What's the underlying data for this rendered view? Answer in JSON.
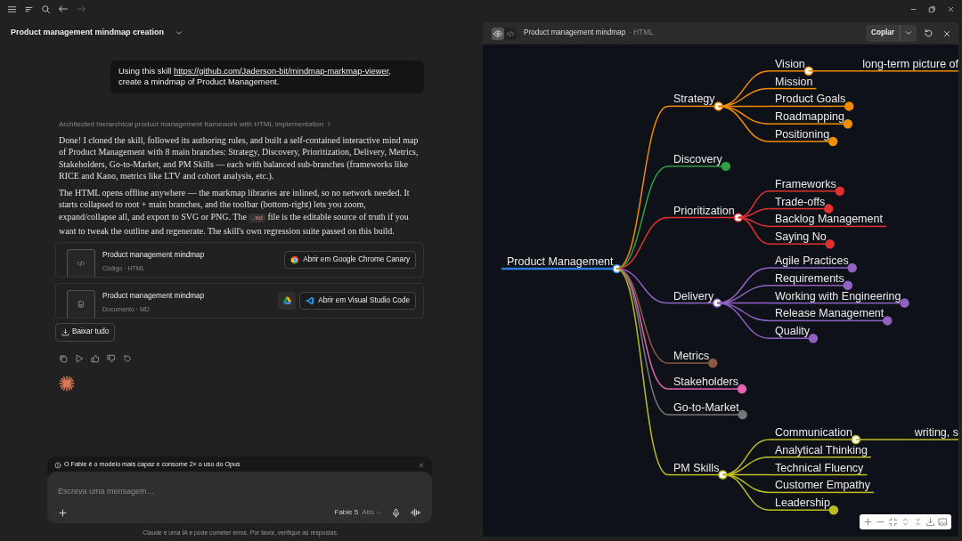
{
  "conversation": {
    "title": "Product management mindmap creation",
    "user_message": {
      "text_before": "Using this skill ",
      "link": "https://github.com/Jaderson-bit/mindmap-markmap-viewer",
      "text_after": ", create a mindmap of Product Management."
    },
    "thinking_summary": "Architected hierarchical product management framework with HTML implementation",
    "paragraphs": [
      {
        "text": "Done! I cloned the skill, followed its authoring rules, and built a self-contained interactive mind map of Product Management with 8 main branches: Strategy, Discovery, Prioritization, Delivery, Metrics, Stakeholders, Go-to-Market, and PM Skills — each with balanced sub-branches (frameworks like RICE and Kano, metrics like LTV and cohort analysis, etc.)."
      },
      {
        "text": "The HTML opens offline anywhere — the markmap libraries are inlined, so no network needed. It starts collapsed to root + main branches, and the toolbar (bottom-right) lets you zoom, expand/collapse all, and export to SVG or PNG. The",
        "code": ".md",
        "text_after": "file is the editable source of truth if you want to tweak the outline and regenerate. The skill's own regression suite passed on this build."
      }
    ],
    "artifacts": [
      {
        "kind": "code",
        "title": "Product management mindmap",
        "subtitle": "Código · HTML",
        "drive": false,
        "open_label": "Abrir em Google Chrome Canary"
      },
      {
        "kind": "document",
        "title": "Product management mindmap",
        "subtitle": "Documento · MD",
        "drive": true,
        "open_label": "Abrir em Visual Studio Code"
      }
    ],
    "download_all": "Baixar tudo"
  },
  "composer": {
    "notice": "O Fable é o modelo mais capaz e consome 2× o uso do Opus",
    "placeholder": "Escreva uma mensagem…",
    "model": "Fable 5",
    "effort": "Alto",
    "disclaimer": "Claude é uma IA e pode cometer erros. Por favor, verifique as respostas."
  },
  "artifact_panel": {
    "title": "Product management mindmap",
    "type": "· HTML",
    "views": [
      {
        "kind": "preview",
        "selected": true
      },
      {
        "kind": "code",
        "selected": false
      }
    ],
    "copy_label": "Coplar"
  },
  "mindmap": {
    "root": {
      "label": "Product Management",
      "color": "#2b7bd8",
      "collapsed": false,
      "children": [
        {
          "label": "Strategy",
          "color": "#f08c00",
          "collapsed": false,
          "children": [
            {
              "label": "Vision",
              "collapsed": false,
              "children": [
                {
                  "label": "long-term picture of",
                  "collapsed": false
                }
              ]
            },
            {
              "label": "Mission",
              "collapsed": false
            },
            {
              "label": "Product Goals",
              "collapsed": true
            },
            {
              "label": "Roadmapping",
              "collapsed": true
            },
            {
              "label": "Positioning",
              "collapsed": true
            }
          ]
        },
        {
          "label": "Discovery",
          "color": "#2f9e44",
          "collapsed": true
        },
        {
          "label": "Prioritization",
          "color": "#e03131",
          "collapsed": false,
          "children": [
            {
              "label": "Frameworks",
              "collapsed": true
            },
            {
              "label": "Trade-offs",
              "collapsed": true
            },
            {
              "label": "Backlog Management",
              "collapsed": false
            },
            {
              "label": "Saying No",
              "collapsed": true
            }
          ]
        },
        {
          "label": "Delivery",
          "color": "#9061c2",
          "collapsed": false,
          "children": [
            {
              "label": "Agile Practices",
              "collapsed": true
            },
            {
              "label": "Requirements",
              "collapsed": true
            },
            {
              "label": "Working with Engineering",
              "collapsed": true
            },
            {
              "label": "Release Management",
              "collapsed": true
            },
            {
              "label": "Quality",
              "collapsed": true
            }
          ]
        },
        {
          "label": "Metrics",
          "color": "#8a5a44",
          "collapsed": true
        },
        {
          "label": "Stakeholders",
          "color": "#e064b0",
          "collapsed": true
        },
        {
          "label": "Go-to-Market",
          "color": "#777777",
          "collapsed": true
        },
        {
          "label": "PM Skills",
          "color": "#bcbc22",
          "collapsed": false,
          "children": [
            {
              "label": "Communication",
              "collapsed": false,
              "children": [
                {
                  "label": "writing, s",
                  "collapsed": false
                }
              ]
            },
            {
              "label": "Analytical Thinking",
              "collapsed": false
            },
            {
              "label": "Technical Fluency",
              "collapsed": false
            },
            {
              "label": "Customer Empathy",
              "collapsed": false
            },
            {
              "label": "Leadership",
              "collapsed": true
            }
          ]
        }
      ]
    }
  }
}
